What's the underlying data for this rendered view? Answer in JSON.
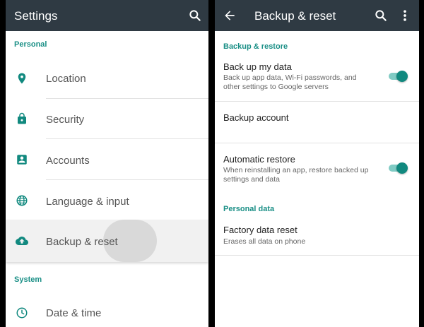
{
  "left_screen": {
    "title": "Settings",
    "sections": {
      "personal": "Personal",
      "system": "System"
    },
    "items": [
      {
        "label": "Location",
        "icon": "location-pin-icon"
      },
      {
        "label": "Security",
        "icon": "lock-icon"
      },
      {
        "label": "Accounts",
        "icon": "account-box-icon"
      },
      {
        "label": "Language & input",
        "icon": "globe-icon"
      },
      {
        "label": "Backup & reset",
        "icon": "cloud-upload-icon"
      },
      {
        "label": "Date & time",
        "icon": "clock-icon"
      }
    ]
  },
  "right_screen": {
    "title": "Backup & reset",
    "sections": {
      "backup_restore": "Backup & restore",
      "personal_data": "Personal data"
    },
    "backup_my_data": {
      "title": "Back up my data",
      "subtitle": "Back up app data, Wi-Fi passwords, and other settings to Google servers",
      "enabled": true
    },
    "backup_account": {
      "title": "Backup account"
    },
    "automatic_restore": {
      "title": "Automatic restore",
      "subtitle": "When reinstalling an app, restore backed up settings and data",
      "enabled": true
    },
    "factory_reset": {
      "title": "Factory data reset",
      "subtitle": "Erases all data on phone"
    }
  },
  "colors": {
    "appbar": "#2f3a43",
    "accent": "#1a8f86",
    "switch_thumb": "#11897f",
    "switch_track": "#80cbc4"
  }
}
